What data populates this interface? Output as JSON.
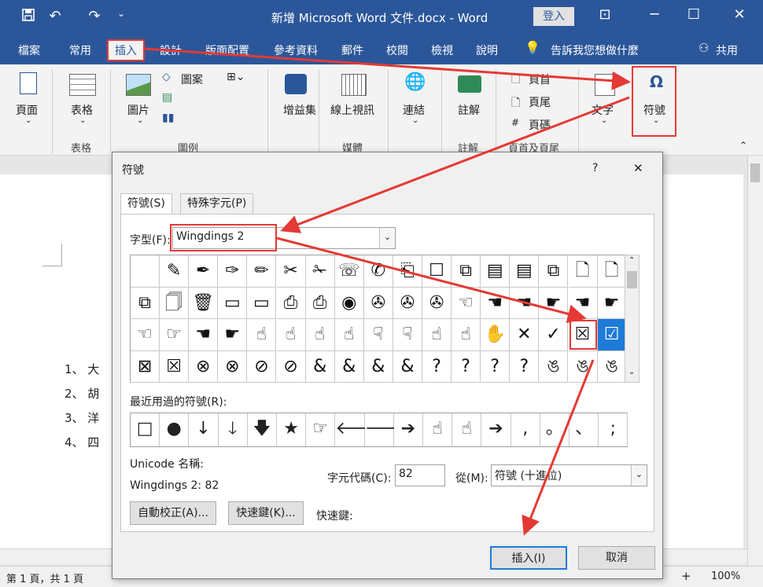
{
  "titlebar": {
    "title": "新增 Microsoft Word 文件.docx  -  Word",
    "signin": "登入",
    "icons": {
      "save": "save-icon",
      "undo": "undo-icon",
      "redo": "redo-icon",
      "customize": "customize-icon"
    }
  },
  "tabs": [
    "檔案",
    "常用",
    "插入",
    "設計",
    "版面配置",
    "參考資料",
    "郵件",
    "校閱",
    "檢視",
    "說明"
  ],
  "tellme": "告訴我您想做什麼",
  "share": "共用",
  "ribbon": {
    "page": "頁面",
    "table": "表格",
    "picture": "圖片",
    "shapes": "圖案",
    "addins": "增益集",
    "online_video": "線上視訊",
    "link": "連結",
    "comment": "註解",
    "header": "頁首",
    "footer": "頁尾",
    "page_number": "頁碼",
    "text": "文字",
    "symbol": "符號",
    "omega": "Ω",
    "groups": {
      "tables": "表格",
      "illustrations": "圖例",
      "media": "媒體",
      "comments": "註解",
      "header_footer": "頁首及頁尾"
    }
  },
  "document": {
    "items": [
      "1、 大",
      "2、 胡",
      "3、 洋",
      "4、 四"
    ]
  },
  "status": {
    "page": "第 1 頁，共 1 頁",
    "zoom": "100%"
  },
  "dialog": {
    "title": "符號",
    "help": "?",
    "close": "✕",
    "tabs": [
      "符號(S)",
      "特殊字元(P)"
    ],
    "font_label": "字型(F):",
    "font_value": "Wingdings 2",
    "symbols": [
      [
        "",
        "✎",
        "✒",
        "✑",
        "✏",
        "✂",
        "✁",
        "☏",
        "✆",
        "⎗",
        "☐",
        "⧉",
        "▤",
        "▤",
        "⧉",
        "🗋",
        "🗋"
      ],
      [
        "⧉",
        "🗍",
        "🗑",
        "▭",
        "▭",
        "⎙",
        "⎙",
        "◉",
        "✇",
        "✇",
        "✇",
        "☜",
        "☚",
        "☚",
        "☛",
        "☚",
        "☛"
      ],
      [
        "☜",
        "☞",
        "☚",
        "☛",
        "☝",
        "☝",
        "☝",
        "☝",
        "☟",
        "☟",
        "☝",
        "☝",
        "✋",
        "✕",
        "✓",
        "☒",
        "☑"
      ],
      [
        "⊠",
        "☒",
        "⊗",
        "⊗",
        "⊘",
        "⊘",
        "&",
        "&",
        "&",
        "&",
        "?",
        "?",
        "?",
        "?",
        "ঙ",
        "ঙ",
        "ঙ"
      ]
    ],
    "recent_label": "最近用過的符號(R):",
    "recent": [
      "□",
      "●",
      "↓",
      "🡓",
      "🡇",
      "★",
      "☞",
      "🡐",
      "🡒",
      "➔",
      "☝",
      "☝",
      "➔",
      ",",
      "。",
      "、",
      ";"
    ],
    "unicode_label": "Unicode 名稱:",
    "unicode_value": "Wingdings 2: 82",
    "charcode_label": "字元代碼(C):",
    "charcode_value": "82",
    "from_label": "從(M):",
    "from_value": "符號 (十進位)",
    "autocorrect": "自動校正(A)...",
    "shortcut_key": "快速鍵(K)...",
    "shortcut_label": "快速鍵:",
    "insert": "插入(I)",
    "cancel": "取消"
  },
  "colors": {
    "brand": "#2b579a",
    "highlight": "#e53935",
    "selection": "#1e7bd8"
  }
}
